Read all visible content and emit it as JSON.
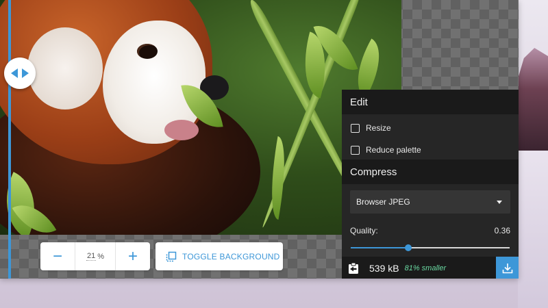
{
  "zoom": {
    "decrease_label": "−",
    "value": "21",
    "unit": "%",
    "increase_label": "+"
  },
  "toolbar": {
    "toggle_background_label": "TOGGLE BACKGROUND",
    "toggle_background_icon": "layers-icon"
  },
  "compare": {
    "handle_icon": "split-arrows-icon"
  },
  "edit": {
    "title": "Edit",
    "options": [
      {
        "label": "Resize",
        "checked": false
      },
      {
        "label": "Reduce palette",
        "checked": false
      }
    ]
  },
  "compress": {
    "title": "Compress",
    "method": "Browser JPEG",
    "quality_label": "Quality:",
    "quality_value": "0.36",
    "quality_fraction": 0.36
  },
  "result": {
    "size": "539 kB",
    "saving": "81% smaller",
    "copy_icon": "copy-settings-icon",
    "download_icon": "download-icon"
  },
  "colors": {
    "accent": "#3d97d8",
    "saving_text": "#6ad9a2",
    "panel_dark": "#1a1a1a",
    "panel_body": "#262626"
  }
}
